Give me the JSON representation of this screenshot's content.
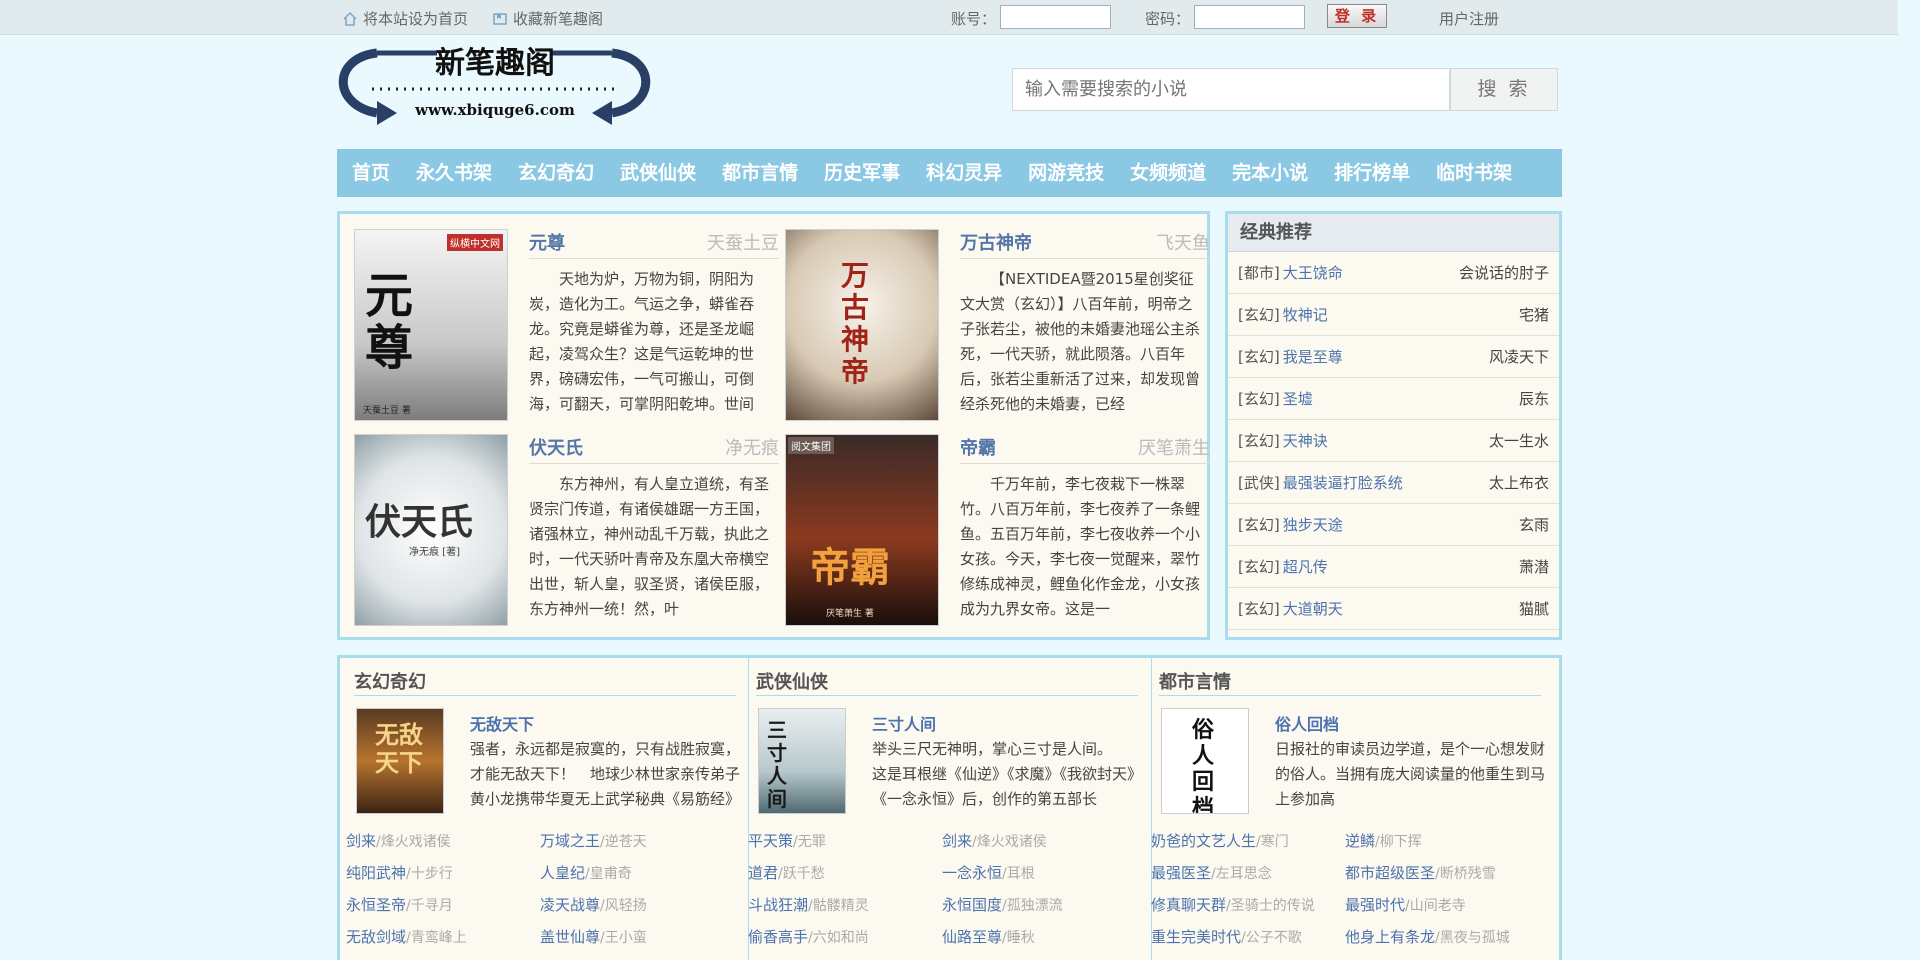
{
  "topbar": {
    "set_home": "将本站设为首页",
    "bookmark": "收藏新笔趣阁",
    "account_label": "账号：",
    "password_label": "密码：",
    "login_button": "登 录",
    "register": "用户注册",
    "icons": [
      "home-icon",
      "bookmark-icon"
    ]
  },
  "logo": {
    "name": "新笔趣阁",
    "url": "www.xbiquge6.com"
  },
  "search": {
    "placeholder": "输入需要搜索的小说",
    "button": "搜 索"
  },
  "nav": {
    "items": [
      "首页",
      "永久书架",
      "玄幻奇幻",
      "武侠仙侠",
      "都市言情",
      "历史军事",
      "科幻灵异",
      "网游竞技",
      "女频频道",
      "完本小说",
      "排行榜单",
      "临时书架"
    ]
  },
  "hot_books": [
    {
      "title": "元尊",
      "author": "天蚕土豆",
      "desc": "天地为炉，万物为铜，阴阳为炭，造化为工。气运之争，蟒雀吞龙。究竟是蟒雀为尊，还是圣龙崛起，凌驾众生？这是气运乾坤的世界，磅礴宏伟，一气可搬山，可倒海，可翻天，可掌阴阳乾坤。世间",
      "cover_text": "元尊",
      "cover_badge": "纵横中文网",
      "cover_footer": "天蚕土豆 著"
    },
    {
      "title": "万古神帝",
      "author": "飞天鱼",
      "desc": "【NEXTIDEA暨2015星创奖征文大赏（玄幻）】八百年前，明帝之子张若尘，被他的未婚妻池瑶公主杀死，一代天骄，就此陨落。八百年后，张若尘重新活了过来，却发现曾经杀死他的未婚妻，已经",
      "cover_text": "万古神帝"
    },
    {
      "title": "伏天氏",
      "author": "净无痕",
      "desc": "东方神州，有人皇立道统，有圣贤宗门传道，有诸侯雄踞一方王国，诸强林立，神州动乱千万载，执此之时，一代天骄叶青帝及东凰大帝横空出世，斩人皇，驭圣贤，诸侯臣服，东方神州一统！然，叶",
      "cover_text": "伏天氏",
      "cover_sub": "净无痕 [著]"
    },
    {
      "title": "帝霸",
      "author": "厌笔萧生",
      "desc": "千万年前，李七夜栽下一株翠竹。八百万年前，李七夜养了一条鲤鱼。五百万年前，李七夜收养一个小女孩。今天，李七夜一觉醒来，翠竹修练成神灵，鲤鱼化作金龙，小女孩成为九界女帝。这是一",
      "cover_text": "帝霸",
      "cover_badge": "阅文集团",
      "cover_footer": "厌笔萧生 著"
    }
  ],
  "recommend": {
    "heading": "经典推荐",
    "items": [
      {
        "cat": "[都市]",
        "name": "大王饶命",
        "author": "会说话的肘子"
      },
      {
        "cat": "[玄幻]",
        "name": "牧神记",
        "author": "宅猪"
      },
      {
        "cat": "[玄幻]",
        "name": "我是至尊",
        "author": "风凌天下"
      },
      {
        "cat": "[玄幻]",
        "name": "圣墟",
        "author": "辰东"
      },
      {
        "cat": "[玄幻]",
        "name": "天神诀",
        "author": "太一生水"
      },
      {
        "cat": "[武侠]",
        "name": "最强装逼打脸系统",
        "author": "太上布衣"
      },
      {
        "cat": "[玄幻]",
        "name": "独步天途",
        "author": "玄雨"
      },
      {
        "cat": "[玄幻]",
        "name": "超凡传",
        "author": "萧潜"
      },
      {
        "cat": "[玄幻]",
        "name": "大道朝天",
        "author": "猫腻"
      }
    ]
  },
  "categories": [
    {
      "heading": "玄幻奇幻",
      "featured": {
        "title": "无敌天下",
        "desc": "强者，永远都是寂寞的，只有战胜寂寞，才能无敌天下！　地球少林世家亲传弟子黄小龙携带华夏无上武学秘典《易筋经》",
        "cover_text": "无敌天下"
      },
      "list": [
        {
          "name": "剑来",
          "author": "/烽火戏诸侯"
        },
        {
          "name": "万域之王",
          "author": "/逆苍天"
        },
        {
          "name": "纯阳武神",
          "author": "/十步行"
        },
        {
          "name": "人皇纪",
          "author": "/皇甫奇"
        },
        {
          "name": "永恒圣帝",
          "author": "/千寻月"
        },
        {
          "name": "凌天战尊",
          "author": "/风轻扬"
        },
        {
          "name": "无敌剑域",
          "author": "/青鸾峰上"
        },
        {
          "name": "盖世仙尊",
          "author": "/王小蛮"
        }
      ]
    },
    {
      "heading": "武侠仙侠",
      "featured": {
        "title": "三寸人间",
        "desc": "举头三尺无神明，掌心三寸是人间。　　这是耳根继《仙逆》《求魔》《我欲封天》《一念永恒》后，创作的第五部长",
        "cover_text": "三寸人间"
      },
      "list": [
        {
          "name": "平天策",
          "author": "/无罪"
        },
        {
          "name": "剑来",
          "author": "/烽火戏诸侯"
        },
        {
          "name": "道君",
          "author": "/跃千愁"
        },
        {
          "name": "一念永恒",
          "author": "/耳根"
        },
        {
          "name": "斗战狂潮",
          "author": "/骷髅精灵"
        },
        {
          "name": "永恒国度",
          "author": "/孤独漂流"
        },
        {
          "name": "偷香高手",
          "author": "/六如和尚"
        },
        {
          "name": "仙路至尊",
          "author": "/睡秋"
        }
      ]
    },
    {
      "heading": "都市言情",
      "featured": {
        "title": "俗人回档",
        "desc": "日报社的审读员边学道，是个一心想发财的俗人。当拥有庞大阅读量的他重生到马上参加高",
        "cover_text": "俗人回档"
      },
      "list": [
        {
          "name": "奶爸的文艺人生",
          "author": "/寒门"
        },
        {
          "name": "逆鳞",
          "author": "/柳下挥"
        },
        {
          "name": "最强医圣",
          "author": "/左耳思念"
        },
        {
          "name": "都市超级医圣",
          "author": "/断桥残雪"
        },
        {
          "name": "修真聊天群",
          "author": "/圣骑士的传说"
        },
        {
          "name": "最强时代",
          "author": "/山间老寺"
        },
        {
          "name": "重生完美时代",
          "author": "/公子不歌"
        },
        {
          "name": "他身上有条龙",
          "author": "/黑夜与孤城"
        }
      ]
    }
  ]
}
